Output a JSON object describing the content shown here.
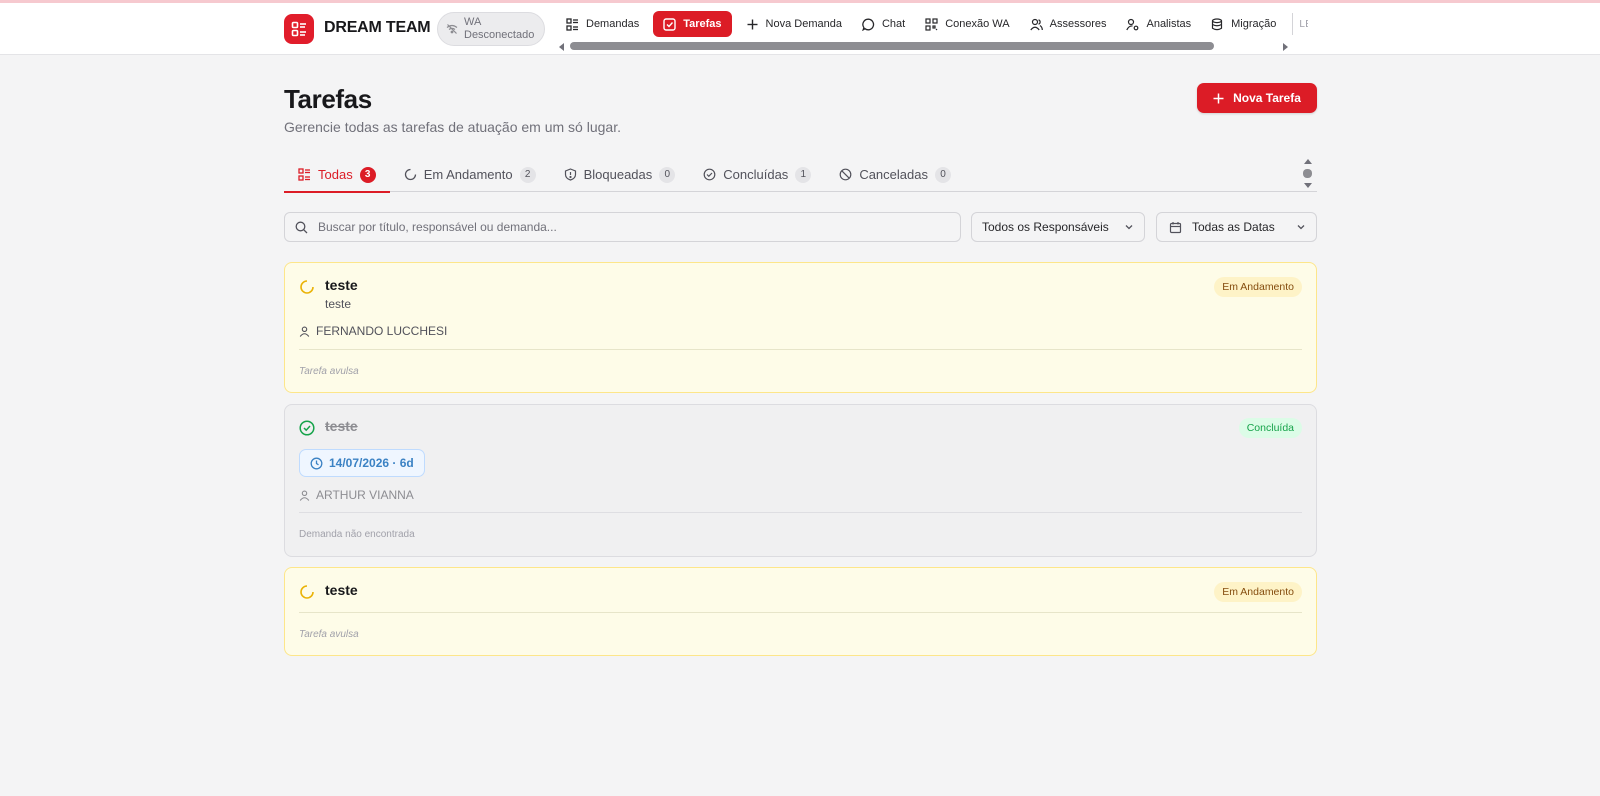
{
  "app": {
    "brand": "DREAM TEAM",
    "wa_status": "WA Desconectado"
  },
  "nav": {
    "items": [
      {
        "label": "Demandas",
        "icon": "list-icon",
        "active": false
      },
      {
        "label": "Tarefas",
        "icon": "check-square-icon",
        "active": true
      },
      {
        "label": "Nova Demanda",
        "icon": "plus-icon",
        "active": false
      },
      {
        "label": "Chat",
        "icon": "chat-bubble-icon",
        "active": false
      },
      {
        "label": "Conexão WA",
        "icon": "qr-code-icon",
        "active": false
      },
      {
        "label": "Assessores",
        "icon": "users-icon",
        "active": false
      },
      {
        "label": "Analistas",
        "icon": "user-cog-icon",
        "active": false
      },
      {
        "label": "Migração",
        "icon": "database-icon",
        "active": false
      }
    ],
    "user_partial": "LETI"
  },
  "page": {
    "title": "Tarefas",
    "subtitle": "Gerencie todas as tarefas de atuação em um só lugar.",
    "new_task_label": "Nova Tarefa"
  },
  "tabs": [
    {
      "label": "Todas",
      "count": "3",
      "active": true
    },
    {
      "label": "Em Andamento",
      "count": "2",
      "active": false
    },
    {
      "label": "Bloqueadas",
      "count": "0",
      "active": false
    },
    {
      "label": "Concluídas",
      "count": "1",
      "active": false
    },
    {
      "label": "Canceladas",
      "count": "0",
      "active": false
    }
  ],
  "filters": {
    "search_placeholder": "Buscar por título, responsável ou demanda...",
    "responsible": "Todos os Responsáveis",
    "dates": "Todas as Datas"
  },
  "tasks": [
    {
      "title": "teste",
      "description": "teste",
      "status": "Em Andamento",
      "assignee": "FERNANDO LUCCHESI",
      "footer": "Tarefa avulsa"
    },
    {
      "title": "teste",
      "status": "Concluída",
      "due": "14/07/2026 · 6d",
      "assignee": "ARTHUR VIANNA",
      "footer": "Demanda não encontrada"
    },
    {
      "title": "teste",
      "status": "Em Andamento",
      "footer": "Tarefa avulsa"
    }
  ],
  "colors": {
    "accent": "#dc1c26",
    "pending_bg": "#fefce8",
    "pending_border": "#fde68a",
    "done_bg": "#f0f0f1",
    "success": "#16a34a",
    "warning": "#eab308"
  }
}
